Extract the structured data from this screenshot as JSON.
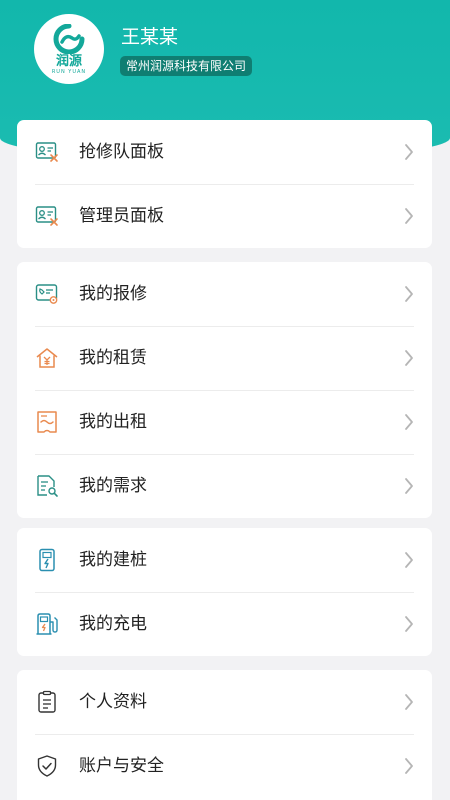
{
  "profile": {
    "logo_cn": "润源",
    "logo_en": "RUN YUAN",
    "name": "王某某",
    "company": "常州润源科技有限公司"
  },
  "colors": {
    "teal": "#1bbcb1",
    "badge": "#0f7e72",
    "orange": "#e98a4f"
  },
  "groups": [
    {
      "items": [
        {
          "label": "抢修队面板",
          "icon": "id-card-wrench-icon"
        },
        {
          "label": "管理员面板",
          "icon": "id-card-wrench-icon"
        }
      ]
    },
    {
      "items": [
        {
          "label": "我的报修",
          "icon": "repair-ticket-icon"
        },
        {
          "label": "我的租赁",
          "icon": "house-yen-icon"
        },
        {
          "label": "我的出租",
          "icon": "rent-out-icon"
        },
        {
          "label": "我的需求",
          "icon": "document-search-icon"
        }
      ]
    },
    {
      "items": [
        {
          "label": "我的建桩",
          "icon": "charging-pile-icon"
        },
        {
          "label": "我的充电",
          "icon": "fuel-charge-icon"
        }
      ]
    },
    {
      "items": [
        {
          "label": "个人资料",
          "icon": "clipboard-icon"
        },
        {
          "label": "账户与安全",
          "icon": "shield-check-icon"
        }
      ]
    }
  ]
}
